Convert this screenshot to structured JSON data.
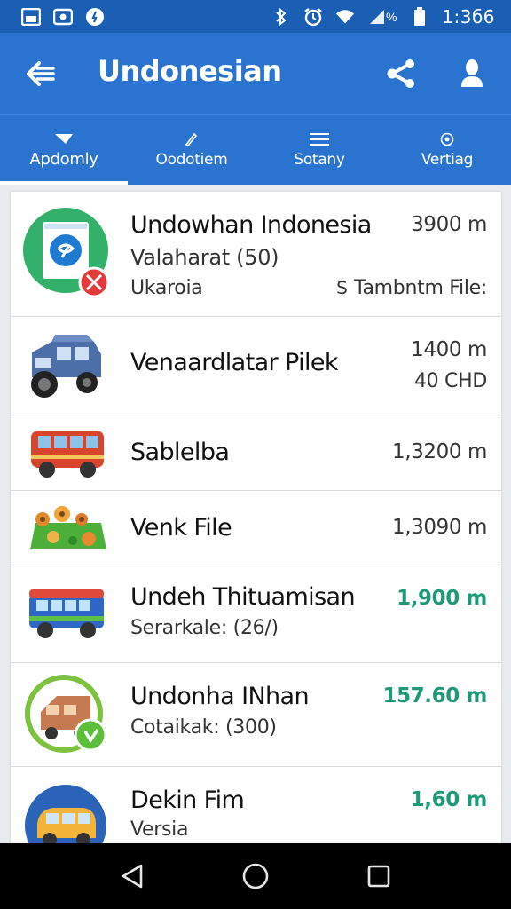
{
  "status_bar": {
    "time": "1:3б6",
    "left_icons": [
      "gallery-icon",
      "image-icon",
      "alert-icon"
    ],
    "right_icons": [
      "bluetooth-icon",
      "alarm-icon",
      "wifi-icon",
      "signal-icon",
      "battery-icon"
    ],
    "signal_label": "%"
  },
  "app_bar": {
    "title": "Undonesian",
    "icons": [
      "back-arrow-icon",
      "share-icon",
      "profile-icon"
    ]
  },
  "tabs": [
    {
      "label": "Apdomly",
      "icon": "flag-icon",
      "active": true
    },
    {
      "label": "Oodotiem",
      "icon": "pencil-icon",
      "active": false
    },
    {
      "label": "Sotany",
      "icon": "menu-icon",
      "active": false
    },
    {
      "label": "Vertiag",
      "icon": "settings-icon",
      "active": false
    }
  ],
  "list": {
    "items": [
      {
        "title": "Undowhan Indonesia",
        "subtitle": "Valaharat (50)",
        "subtitle2": "Ukaroia",
        "distance": "3900 m",
        "extra": "$ Tambntm File:",
        "icon": "app-store-icon"
      },
      {
        "title": "Venaardlatar Pilek",
        "distance": "1400 m",
        "extra": "40 CHD",
        "icon": "truck-icon"
      },
      {
        "title": "Sablelba",
        "distance": "1,3200 m",
        "icon": "bus-icon"
      },
      {
        "title": "Venk File",
        "distance": "1,3090 m",
        "icon": "garden-icon"
      },
      {
        "title": "Undeh Thituamisan",
        "subtitle": "Serarkale: (26/)",
        "distance": "1,900 m",
        "distance_color": "#1e9a7a",
        "icon": "van-icon"
      },
      {
        "title": "Undonha INhan",
        "subtitle": "Cotaikak: (300)",
        "distance": "157.60 m",
        "distance_color": "#1e9a7a",
        "icon": "house-van-icon"
      },
      {
        "title": "Dekin Fim",
        "subtitle": "Versia",
        "distance": "1,60 m",
        "distance_color": "#1e9a7a",
        "icon": "yellow-van-icon"
      }
    ]
  },
  "nav_bar": {
    "icons": [
      "back-triangle-icon",
      "home-circle-icon",
      "recents-square-icon"
    ]
  },
  "colors": {
    "status_bar": "#1a5fb4",
    "app_bar": "#2a74cf",
    "accent_green": "#1e9a7a"
  }
}
